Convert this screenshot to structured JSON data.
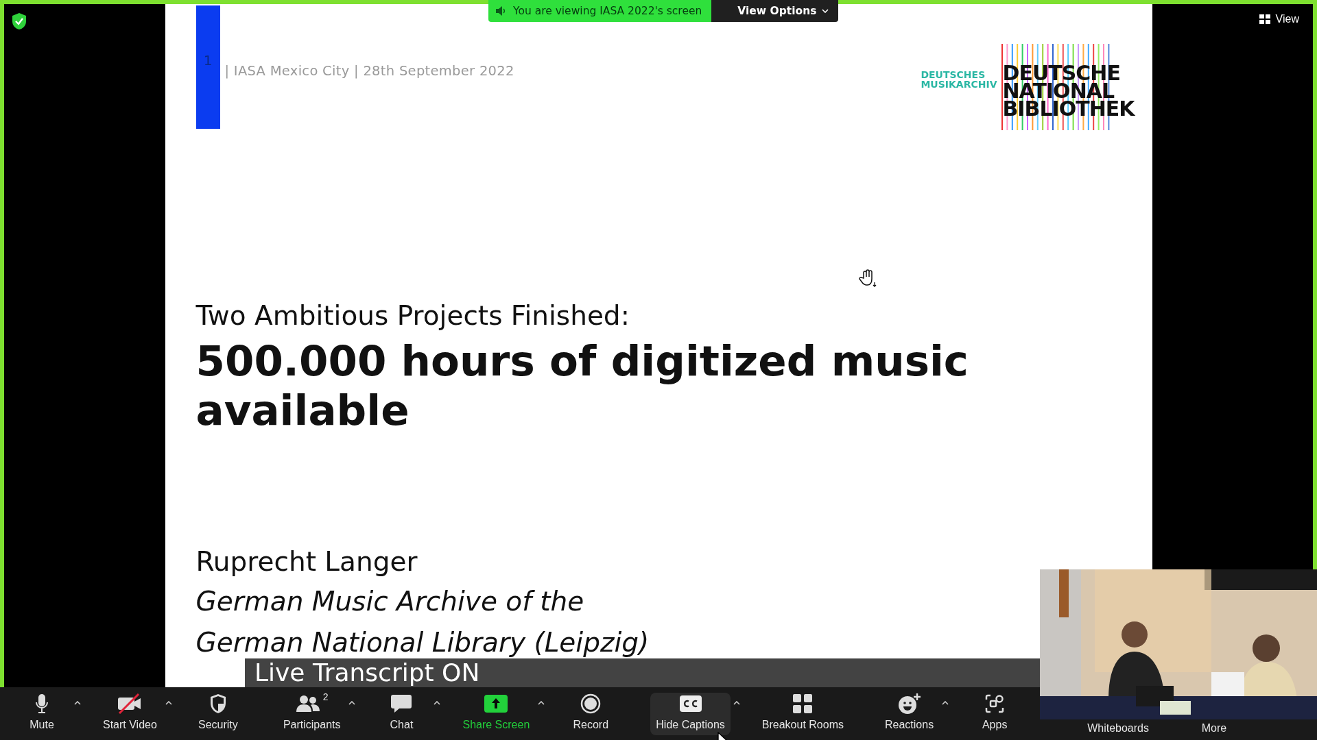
{
  "top_bar": {
    "banner": "You are viewing IASA 2022's screen",
    "view_options": "View Options",
    "view_button": "View"
  },
  "slide": {
    "slide_number": "1",
    "header": "| IASA Mexico City | 28th September 2022",
    "logo": {
      "subtitle_lines": [
        "DEUTSCHES",
        "MUSIKARCHIV"
      ],
      "title_lines": [
        "DEUTSCHE",
        "NATIONAL",
        "BIBLIOTHEK"
      ]
    },
    "subtitle": "Two Ambitious Projects Finished:",
    "headline": "500.000 hours of digitized music available",
    "author": "Ruprecht Langer",
    "affiliation_lines": [
      "German Music Archive of the",
      "German National Library (Leipzig)"
    ]
  },
  "caption": "Live Transcript ON",
  "toolbar": [
    {
      "label": "Mute",
      "kind": "mic",
      "has_menu": true,
      "active": false
    },
    {
      "label": "Start Video",
      "kind": "video-off",
      "has_menu": true,
      "active": false
    },
    {
      "label": "Security",
      "kind": "security",
      "has_menu": false,
      "active": false
    },
    {
      "label": "Participants",
      "kind": "participants",
      "count": "2",
      "has_menu": true,
      "active": false
    },
    {
      "label": "Chat",
      "kind": "chat",
      "has_menu": true,
      "active": false
    },
    {
      "label": "Share Screen",
      "kind": "share",
      "has_menu": true,
      "active": false
    },
    {
      "label": "Record",
      "kind": "record",
      "has_menu": false,
      "active": false
    },
    {
      "label": "Hide Captions",
      "kind": "captions",
      "has_menu": true,
      "active": true
    },
    {
      "label": "Breakout Rooms",
      "kind": "breakout",
      "has_menu": false,
      "active": false
    },
    {
      "label": "Reactions",
      "kind": "reactions",
      "has_menu": true,
      "active": false
    },
    {
      "label": "Apps",
      "kind": "apps",
      "has_menu": false,
      "active": false
    },
    {
      "label": "Whiteboards",
      "kind": "hidden",
      "has_menu": false,
      "active": false
    },
    {
      "label": "More",
      "kind": "hidden",
      "has_menu": false,
      "active": false
    }
  ]
}
